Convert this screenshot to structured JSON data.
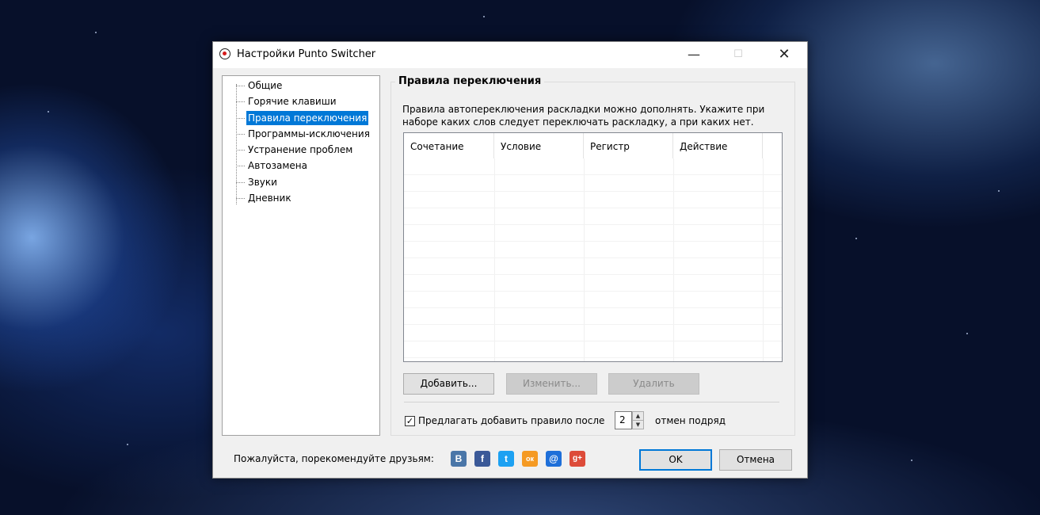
{
  "window": {
    "title": "Настройки Punto Switcher",
    "minimize": "—",
    "maximize": "☐",
    "close": "✕"
  },
  "sidebar": {
    "items": [
      {
        "label": "Общие"
      },
      {
        "label": "Горячие клавиши"
      },
      {
        "label": "Правила переключения",
        "selected": true
      },
      {
        "label": "Программы-исключения"
      },
      {
        "label": "Устранение проблем"
      },
      {
        "label": "Автозамена"
      },
      {
        "label": "Звуки"
      },
      {
        "label": "Дневник"
      }
    ]
  },
  "main": {
    "section_title": "Правила переключения",
    "description": "Правила автопереключения раскладки можно дополнять. Укажите при наборе каких слов следует переключать раскладку, а при каких нет.",
    "table": {
      "columns": [
        "Сочетание",
        "Условие",
        "Регистр",
        "Действие"
      ],
      "rows": []
    },
    "buttons": {
      "add": "Добавить...",
      "edit": "Изменить...",
      "delete": "Удалить"
    },
    "suggest": {
      "checked": true,
      "check_mark": "✓",
      "label": "Предлагать добавить правило после",
      "value": "2",
      "after_label": "отмен подряд"
    }
  },
  "footer": {
    "recommend": "Пожалуйста, порекомендуйте друзьям:",
    "social": [
      {
        "name": "vk-icon",
        "glyph": "В",
        "color": "#4a76a8"
      },
      {
        "name": "facebook-icon",
        "glyph": "f",
        "color": "#3b5998"
      },
      {
        "name": "twitter-icon",
        "glyph": "t",
        "color": "#1da1f2"
      },
      {
        "name": "odnoklassniki-icon",
        "glyph": "ок",
        "color": "#f59a23"
      },
      {
        "name": "mailru-icon",
        "glyph": "@",
        "color": "#1e6fd9"
      },
      {
        "name": "googleplus-icon",
        "glyph": "g+",
        "color": "#dd4b39"
      }
    ],
    "ok": "OK",
    "cancel": "Отмена"
  }
}
